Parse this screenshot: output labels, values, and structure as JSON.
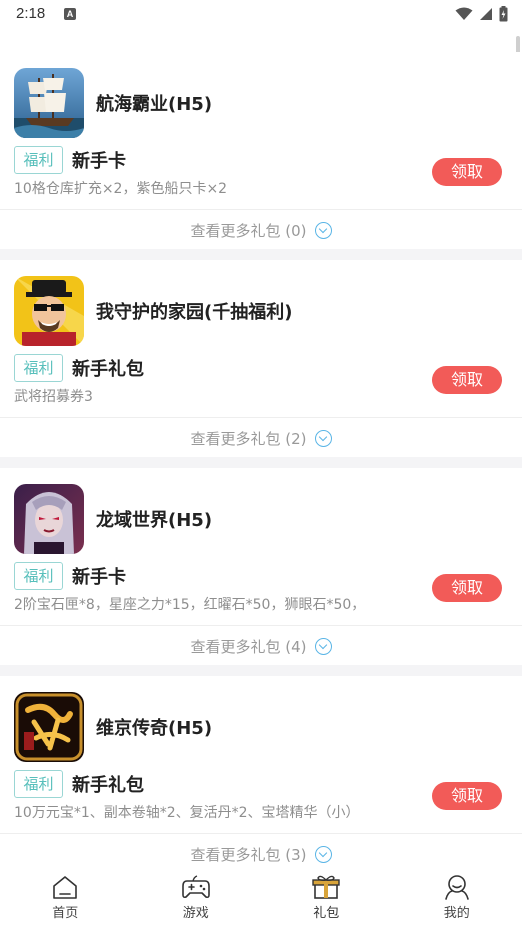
{
  "status_bar": {
    "time": "2:18",
    "notification_letter": "A"
  },
  "colors": {
    "accent_claim": "#f25b58",
    "tag_teal": "#57bfbb",
    "chevron_blue": "#5ab5e6",
    "active_tab_icon": "#d8a43a"
  },
  "gifts": [
    {
      "game_title": "航海霸业(H5)",
      "icon": "sailing-ship-icon",
      "tag": "福利",
      "gift_name": "新手卡",
      "description": "10格仓库扩充×2，紫色船只卡×2",
      "claim_label": "领取",
      "more_label": "查看更多礼包 (0)"
    },
    {
      "game_title": "我守护的家园(千抽福利)",
      "icon": "cartoon-warrior-icon",
      "tag": "福利",
      "gift_name": "新手礼包",
      "description": "武将招募券3",
      "claim_label": "领取",
      "more_label": "查看更多礼包 (2)"
    },
    {
      "game_title": "龙域世界(H5)",
      "icon": "dark-heroine-icon",
      "tag": "福利",
      "gift_name": "新手卡",
      "description": "2阶宝石匣*8，星座之力*15，红曜石*50，狮眼石*50，",
      "claim_label": "领取",
      "more_label": "查看更多礼包 (4)"
    },
    {
      "game_title": "维京传奇(H5)",
      "icon": "legend-emblem-icon",
      "tag": "福利",
      "gift_name": "新手礼包",
      "description": "10万元宝*1、副本卷轴*2、复活丹*2、宝塔精华（小）",
      "claim_label": "领取",
      "more_label": "查看更多礼包 (3)"
    }
  ],
  "tabbar": {
    "tabs": [
      {
        "label": "首页",
        "icon": "home-icon"
      },
      {
        "label": "游戏",
        "icon": "gamepad-icon"
      },
      {
        "label": "礼包",
        "icon": "gift-icon",
        "active": true
      },
      {
        "label": "我的",
        "icon": "profile-icon"
      }
    ]
  }
}
